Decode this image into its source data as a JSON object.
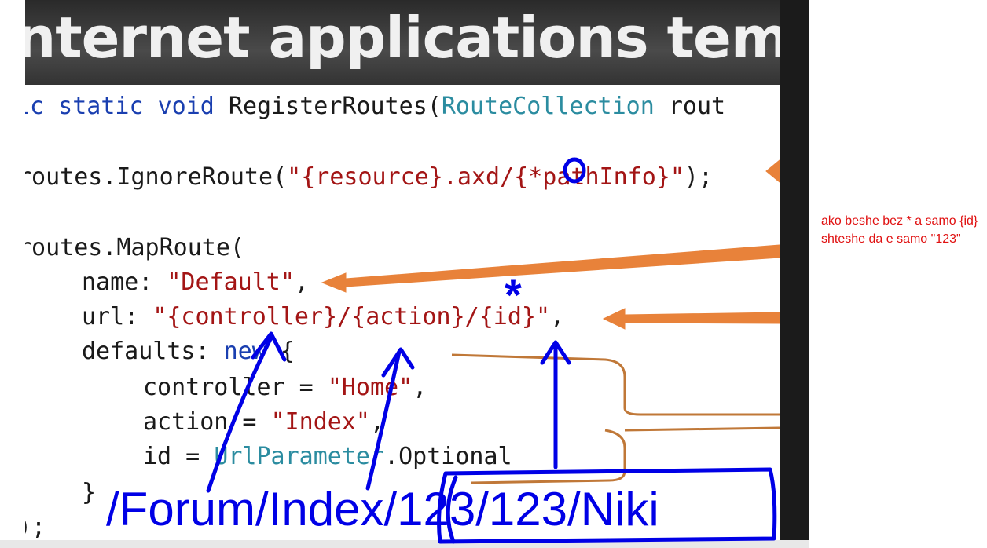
{
  "slide": {
    "title": "nternet applications template b",
    "code": {
      "l1_kw": "ic static void",
      "l1_method": " RegisterRoutes(",
      "l1_type": "RouteCollection",
      "l1_rest": " rout",
      "l2_pre": "routes.IgnoreRoute(",
      "l2_str": "\"{resource}.axd/{*pathInfo}\"",
      "l2_post": ");",
      "l3": "routes.MapRoute(",
      "l4_key": "name: ",
      "l4_str": "\"Default\"",
      "l4_post": ",",
      "l5_key": "url: ",
      "l5_str": "\"{controller}/{action}/{id}\"",
      "l5_post": ",",
      "l6_key": "defaults: ",
      "l6_kw": "new",
      "l6_post": " {",
      "l7_key": "controller = ",
      "l7_str": "\"Home\"",
      "l7_post": ",",
      "l8_key": "action = ",
      "l8_str": "\"Index\"",
      "l8_post": ",",
      "l9_key": "id = ",
      "l9_type": "UrlParameter",
      "l9_post": ".Optional",
      "l10": "}",
      "l11": ");"
    }
  },
  "annotation": {
    "url_text": "/Forum/Index/123/123/Niki",
    "star": "*"
  },
  "note": {
    "text": "ako beshe bez * a samo {id} shteshe da e samo \"123\""
  },
  "colors": {
    "annotation_blue": "#0000e6",
    "arrow_orange": "#e8823a",
    "note_red": "#e01010"
  }
}
